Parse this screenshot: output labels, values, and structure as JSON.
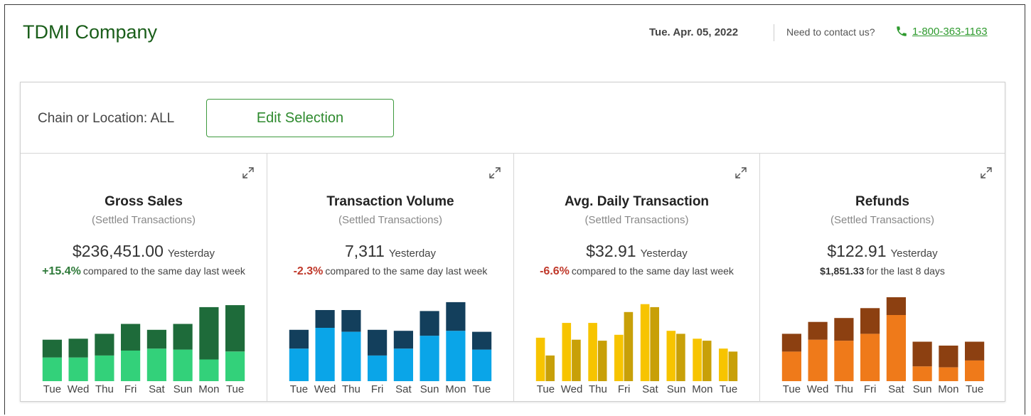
{
  "header": {
    "company": "TDMI Company",
    "date": "Tue. Apr. 05, 2022",
    "contact_label": "Need to contact us?",
    "phone": "1-800-363-1163"
  },
  "filter": {
    "label": "Chain or Location: ALL",
    "edit_button": "Edit Selection"
  },
  "colors": {
    "brand_green": "#1a5e1a",
    "link_green": "#2e9a2e",
    "positive": "#2f7a3a",
    "negative": "#c0392b"
  },
  "cards": [
    {
      "id": "gross-sales",
      "title": "Gross Sales",
      "subtitle": "(Settled Transactions)",
      "value": "$236,451.00",
      "value_suffix": "Yesterday",
      "compare_value": "+15.4%",
      "compare_text": "compared to the same day last week",
      "compare_sign": "positive",
      "icon": "expand-icon"
    },
    {
      "id": "transaction-volume",
      "title": "Transaction Volume",
      "subtitle": "(Settled Transactions)",
      "value": "7,311",
      "value_suffix": "Yesterday",
      "compare_value": "-2.3%",
      "compare_text": "compared to the same day last week",
      "compare_sign": "negative",
      "icon": "expand-icon"
    },
    {
      "id": "avg-daily-transaction",
      "title": "Avg. Daily Transaction",
      "subtitle": "(Settled Transactions)",
      "value": "$32.91",
      "value_suffix": "Yesterday",
      "compare_value": "-6.6%",
      "compare_text": "compared to the same day last week",
      "compare_sign": "negative",
      "icon": "expand-icon"
    },
    {
      "id": "refunds",
      "title": "Refunds",
      "subtitle": "(Settled Transactions)",
      "value": "$122.91",
      "value_suffix": "Yesterday",
      "compare_value": "$1,851.33",
      "compare_text": "for the last 8 days",
      "compare_sign": "neutral",
      "icon": "expand-icon"
    }
  ],
  "chart_data": [
    {
      "type": "bar",
      "stacked": true,
      "categories": [
        "Tue",
        "Wed",
        "Thu",
        "Fri",
        "Sat",
        "Sun",
        "Mon",
        "Tue"
      ],
      "series": [
        {
          "values": [
            24,
            24,
            26,
            31,
            33,
            32,
            22,
            30
          ],
          "color": "#33d17a"
        },
        {
          "values": [
            18,
            19,
            22,
            27,
            19,
            26,
            53,
            47
          ],
          "color": "#1e6b3a"
        }
      ],
      "ylim": [
        0,
        85
      ]
    },
    {
      "type": "bar",
      "stacked": true,
      "categories": [
        "Tue",
        "Wed",
        "Thu",
        "Fri",
        "Sat",
        "Sun",
        "Mon",
        "Tue"
      ],
      "series": [
        {
          "values": [
            33,
            54,
            50,
            26,
            33,
            46,
            51,
            32
          ],
          "color": "#0aa5e8"
        },
        {
          "values": [
            19,
            18,
            22,
            26,
            18,
            25,
            29,
            18
          ],
          "color": "#133f5c"
        }
      ],
      "ylim": [
        0,
        85
      ]
    },
    {
      "type": "bar",
      "grouped": true,
      "categories": [
        "Tue",
        "Wed",
        "Thu",
        "Fri",
        "Sat",
        "Sun",
        "Mon",
        "Tue"
      ],
      "series": [
        {
          "values": [
            44,
            59,
            59,
            47,
            78,
            51,
            43,
            33
          ],
          "color": "#f7c400"
        },
        {
          "values": [
            26,
            42,
            41,
            70,
            75,
            48,
            41,
            30
          ],
          "color": "#c8a008"
        }
      ],
      "ylim": [
        0,
        85
      ]
    },
    {
      "type": "bar",
      "stacked": true,
      "categories": [
        "Tue",
        "Wed",
        "Thu",
        "Fri",
        "Sat",
        "Sun",
        "Mon",
        "Tue"
      ],
      "series": [
        {
          "values": [
            30,
            42,
            41,
            48,
            67,
            15,
            14,
            21
          ],
          "color": "#ef7a1a"
        },
        {
          "values": [
            18,
            18,
            23,
            26,
            18,
            25,
            22,
            19
          ],
          "color": "#8c4011"
        }
      ],
      "ylim": [
        0,
        85
      ]
    }
  ]
}
